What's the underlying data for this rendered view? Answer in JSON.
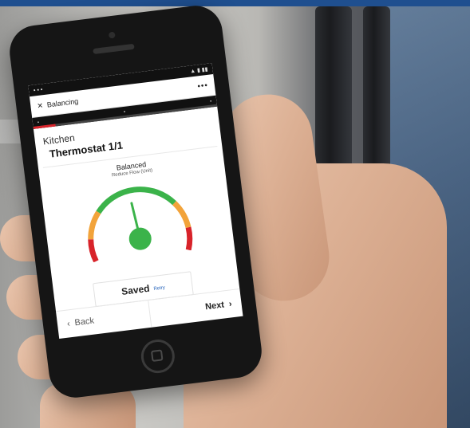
{
  "phone": {
    "app_title": "Balancing",
    "location": "Kitchen",
    "device_name": "Thermostat 1/1",
    "status": "Balanced",
    "substatus": "Reduce Flow (Unit)",
    "saved_label": "Saved",
    "saved_action": "Retry",
    "back_label": "Back",
    "next_label": "Next",
    "progress_fraction": 0.12,
    "gauge_needle_fraction": 0.47
  },
  "colors": {
    "accent_red": "#d8232a",
    "gauge_green": "#3bb34a",
    "gauge_orange": "#f2a33a",
    "link_blue": "#1e5eb8"
  },
  "icons": {
    "close": "close-icon",
    "menu": "more-icon",
    "back": "chevron-left-icon",
    "next": "chevron-right-icon"
  }
}
